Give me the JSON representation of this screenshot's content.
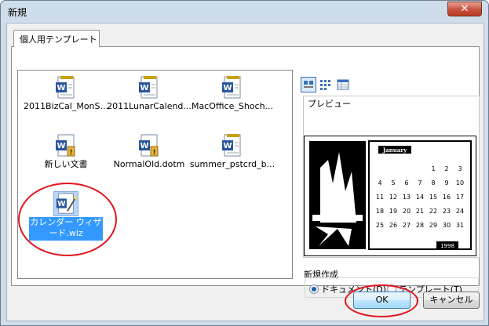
{
  "window": {
    "title": "新規",
    "close_glyph": "✕"
  },
  "tab": {
    "label": "個人用テンプレート"
  },
  "templates": [
    {
      "label": "2011BizCal_MonS...",
      "icon": "word-template-icon"
    },
    {
      "label": "2011LunarCalend...",
      "icon": "word-template-icon"
    },
    {
      "label": "MacOffice_Shoch...",
      "icon": "word-template-icon"
    },
    {
      "label": "新しい文書",
      "icon": "word-macro-template-icon"
    },
    {
      "label": "NormalOld.dotm",
      "icon": "word-macro-template-icon"
    },
    {
      "label": "summer_pstcrd_b...",
      "icon": "word-template-icon"
    },
    {
      "label": "カレンダー ウィザード.wiz",
      "icon": "word-wizard-icon",
      "selected": true
    }
  ],
  "preview": {
    "label": "プレビュー",
    "calendar_month": "January",
    "calendar_year": "1998",
    "calendar_days": [
      "1",
      "2",
      "3",
      "4",
      "5",
      "6",
      "7",
      "8",
      "9",
      "10",
      "11",
      "12",
      "13",
      "14",
      "15",
      "16",
      "17",
      "18",
      "19",
      "20",
      "21",
      "22",
      "23",
      "24",
      "25",
      "26",
      "27",
      "28",
      "29",
      "30",
      "31"
    ]
  },
  "new_type": {
    "label": "新規作成",
    "options": [
      {
        "label": "ドキュメント(D)",
        "selected": true
      },
      {
        "label": "テンプレート(T)",
        "selected": false
      }
    ]
  },
  "buttons": {
    "ok": "OK",
    "cancel": "キャンセル"
  },
  "colors": {
    "selection": "#3399ff",
    "annotation": "#e0141e",
    "word_blue": "#2b579a"
  }
}
